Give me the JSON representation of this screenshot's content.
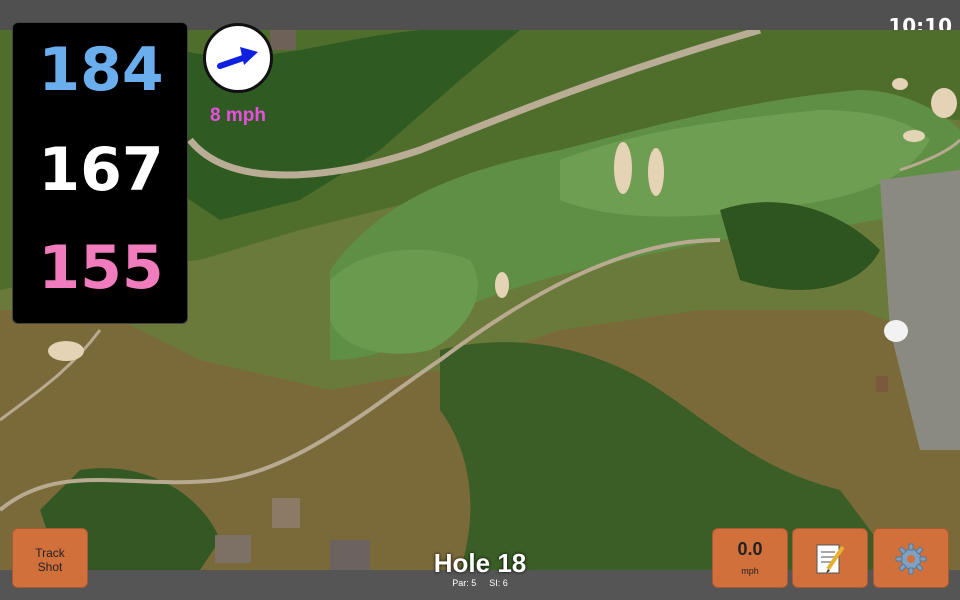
{
  "status": {
    "time": "10:10"
  },
  "distances": {
    "back": "184",
    "center": "167",
    "front": "155"
  },
  "wind": {
    "speed_label": "8 mph"
  },
  "buttons": {
    "track_shot": [
      "Track",
      "Shot"
    ],
    "speed_value": "0.0",
    "speed_unit": "mph"
  },
  "hole": {
    "title": "Hole 18",
    "par": "Par: 5",
    "si": "SI: 6"
  },
  "colors": {
    "back_distance": "#6aaeee",
    "center_distance": "#ffffff",
    "front_distance": "#f07cbd",
    "wind_text": "#e84fe0",
    "button": "#d2703c",
    "arrow": "#1020e0"
  }
}
